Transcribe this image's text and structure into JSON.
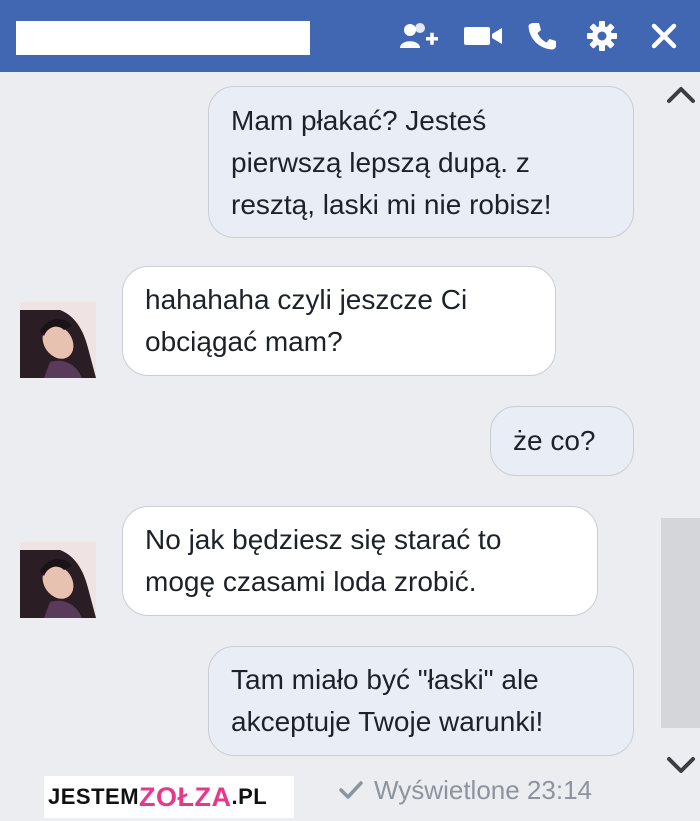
{
  "header": {
    "icons": [
      "add-people-icon",
      "video-call-icon",
      "phone-call-icon",
      "gear-icon",
      "close-icon"
    ],
    "background": "#4267b2"
  },
  "messages": [
    {
      "direction": "outgoing",
      "text": "Mam płakać? Jesteś\npierwszą lepszą dupą. z\nresztą, laski mi nie robisz!"
    },
    {
      "direction": "incoming",
      "text": "hahahaha czyli jeszcze Ci\nobciągać mam?"
    },
    {
      "direction": "outgoing",
      "text": "że co?"
    },
    {
      "direction": "incoming",
      "text": "No jak będziesz się starać to\nmogę czasami loda zrobić."
    },
    {
      "direction": "outgoing",
      "text": "Tam miało być \"łaski\" ale\nakceptuje Twoje warunki!"
    }
  ],
  "status": {
    "seen_text": "Wyświetlone 23:14",
    "seen_icon": "checkmark-icon"
  },
  "watermark": {
    "part1": "JESTEM",
    "part2": "ZOŁZA",
    "part3": ".PL"
  },
  "colors": {
    "outgoing_bubble": "#e9eef6",
    "incoming_bubble": "#ffffff",
    "chat_background": "#ebedf0"
  }
}
